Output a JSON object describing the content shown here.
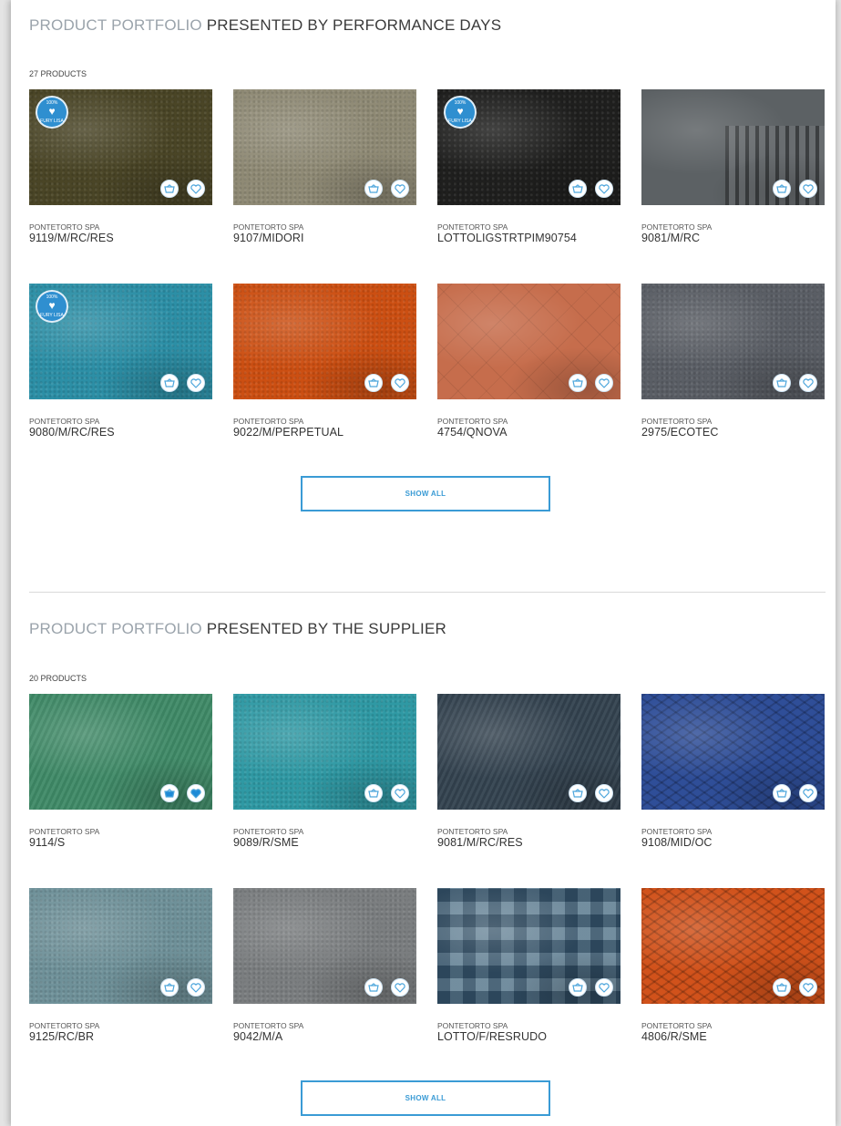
{
  "sections": [
    {
      "heading_light": "PRODUCT PORTFOLIO",
      "heading_dark": "PRESENTED BY PERFORMANCE DAYS",
      "count": "27 PRODUCTS",
      "show_all": "SHOW ALL",
      "products": [
        {
          "supplier": "PONTETORTO SPA",
          "code": "9119/M/RC/RES",
          "color": "#4a4526",
          "badge": true,
          "texture": "fleck"
        },
        {
          "supplier": "PONTETORTO SPA",
          "code": "9107/MIDORI",
          "color": "#8f8a75",
          "badge": false,
          "texture": "fleck"
        },
        {
          "supplier": "PONTETORTO SPA",
          "code": "LOTTOLIGSTRTPIM90754",
          "color": "#1f1f1e",
          "badge": true,
          "texture": "fleck"
        },
        {
          "supplier": "PONTETORTO SPA",
          "code": "9081/M/RC",
          "color": "#5c6164",
          "badge": false,
          "texture": "rib"
        },
        {
          "supplier": "PONTETORTO SPA",
          "code": "9080/M/RC/RES",
          "color": "#2c8fa6",
          "badge": true,
          "texture": "fleck"
        },
        {
          "supplier": "PONTETORTO SPA",
          "code": "9022/M/PERPETUAL",
          "color": "#cc4f12",
          "badge": false,
          "texture": "fleck"
        },
        {
          "supplier": "PONTETORTO SPA",
          "code": "4754/QNOVA",
          "color": "#c66d4c",
          "badge": false,
          "texture": "diamond"
        },
        {
          "supplier": "PONTETORTO SPA",
          "code": "2975/ECOTEC",
          "color": "#5a5e65",
          "badge": false,
          "texture": "fleck"
        }
      ]
    },
    {
      "heading_light": "PRODUCT PORTFOLIO",
      "heading_dark": "PRESENTED BY THE SUPPLIER",
      "count": "20 PRODUCTS",
      "show_all": "SHOW ALL",
      "products": [
        {
          "supplier": "PONTETORTO SPA",
          "code": "9114/S",
          "color": "#3f8a67",
          "badge": false,
          "texture": "stripe",
          "filled": true
        },
        {
          "supplier": "PONTETORTO SPA",
          "code": "9089/R/SME",
          "color": "#2f99a4",
          "badge": false,
          "texture": "fleck"
        },
        {
          "supplier": "PONTETORTO SPA",
          "code": "9081/M/RC/RES",
          "color": "#33424f",
          "badge": false,
          "texture": "stripe"
        },
        {
          "supplier": "PONTETORTO SPA",
          "code": "9108/MID/OC",
          "color": "#2f4e98",
          "badge": false,
          "texture": "grid"
        },
        {
          "supplier": "PONTETORTO SPA",
          "code": "9125/RC/BR",
          "color": "#6f9199",
          "badge": false,
          "texture": "fleck"
        },
        {
          "supplier": "PONTETORTO SPA",
          "code": "9042/M/A",
          "color": "#7b7e80",
          "badge": false,
          "texture": "fleck"
        },
        {
          "supplier": "PONTETORTO SPA",
          "code": "LOTTO/F/RESRUDO",
          "color": "#4d6f85",
          "badge": false,
          "texture": "plaid"
        },
        {
          "supplier": "PONTETORTO SPA",
          "code": "4806/R/SME",
          "color": "#d1521b",
          "badge": false,
          "texture": "grid"
        }
      ]
    }
  ],
  "badge": {
    "top": "100%",
    "bottom": "FURY LISA"
  },
  "icons": {
    "basket": "basket-icon",
    "favorite": "heart-icon",
    "badge_heart": "heart-icon"
  },
  "accent_color": "#3a9bd5"
}
